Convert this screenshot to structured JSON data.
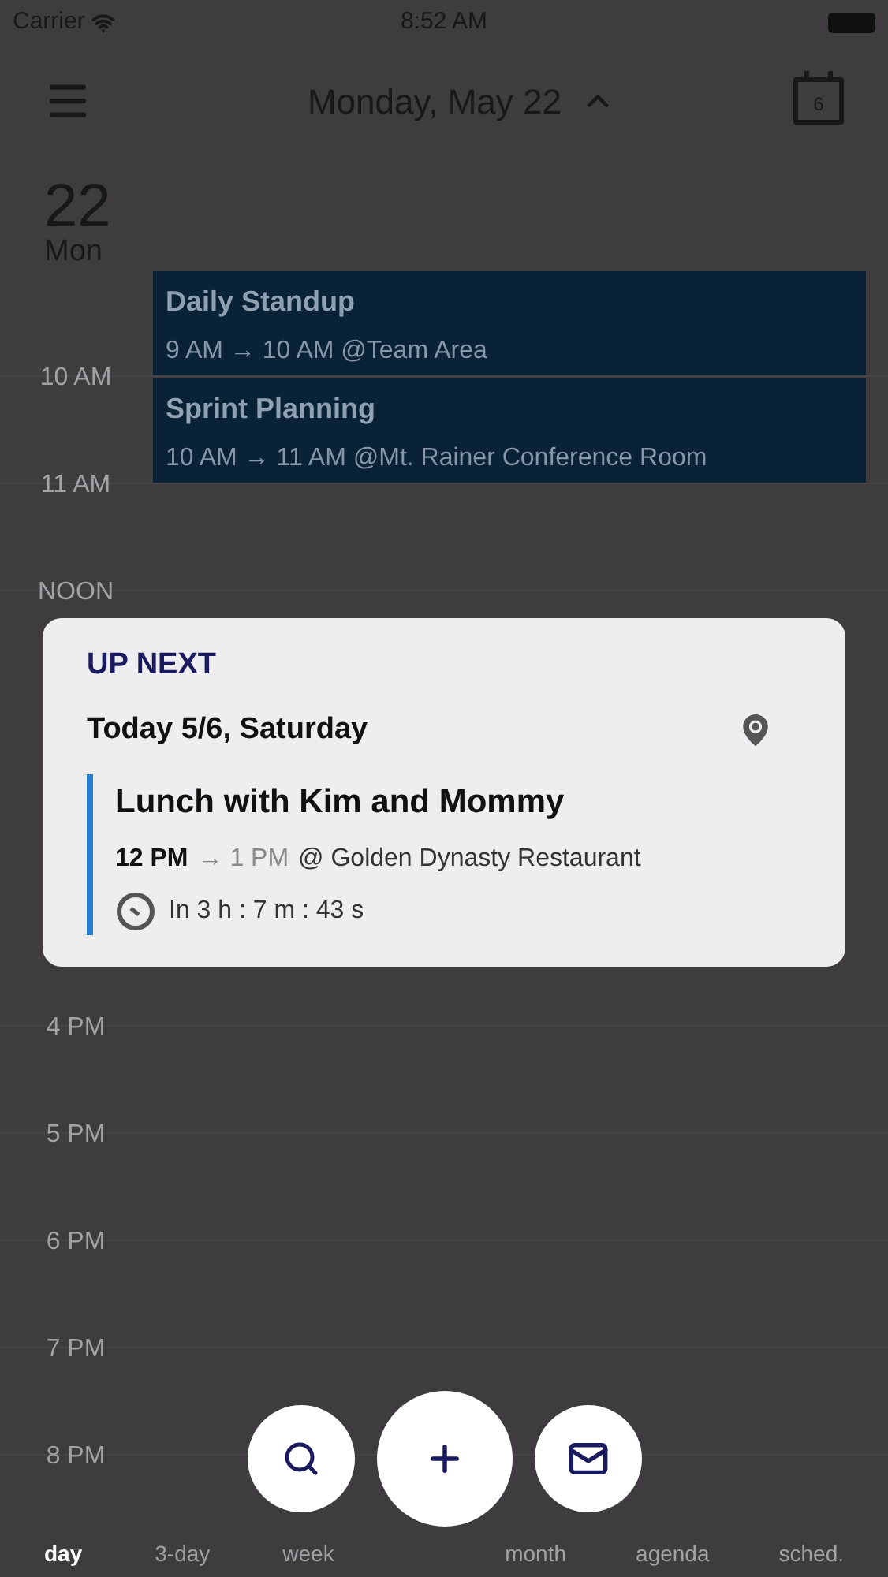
{
  "status_bar": {
    "carrier": "Carrier",
    "time": "8:52 AM"
  },
  "header": {
    "title": "Monday, May 22",
    "calendar_day": "6"
  },
  "day": {
    "number": "22",
    "weekday": "Mon"
  },
  "events": [
    {
      "title": "Daily Standup",
      "time": "9 AM → 10 AM @Team Area"
    },
    {
      "title": "Sprint Planning",
      "time": "10 AM → 11 AM @Mt. Rainer Conference Room"
    }
  ],
  "hours_top": [
    "10 AM",
    "11 AM",
    "NOON"
  ],
  "up_next": {
    "heading": "UP NEXT",
    "date": "Today 5/6, Saturday",
    "title": "Lunch with Kim and Mommy",
    "start": "12 PM",
    "end": "→ 1 PM",
    "place": "@ Golden Dynasty Restaurant",
    "countdown": "In 3 h : 7 m : 43 s"
  },
  "hours_bottom": [
    "4 PM",
    "5 PM",
    "6 PM",
    "7 PM",
    "8 PM"
  ],
  "tabs_left": [
    {
      "label": "day",
      "selected": true
    },
    {
      "label": "3-day",
      "selected": false
    },
    {
      "label": "week",
      "selected": false
    }
  ],
  "tabs_right": [
    {
      "label": "month",
      "selected": false
    },
    {
      "label": "agenda",
      "selected": false
    },
    {
      "label": "sched.",
      "selected": false
    }
  ],
  "fabs": [
    {
      "kind": "search"
    },
    {
      "kind": "add"
    },
    {
      "kind": "mail"
    }
  ]
}
